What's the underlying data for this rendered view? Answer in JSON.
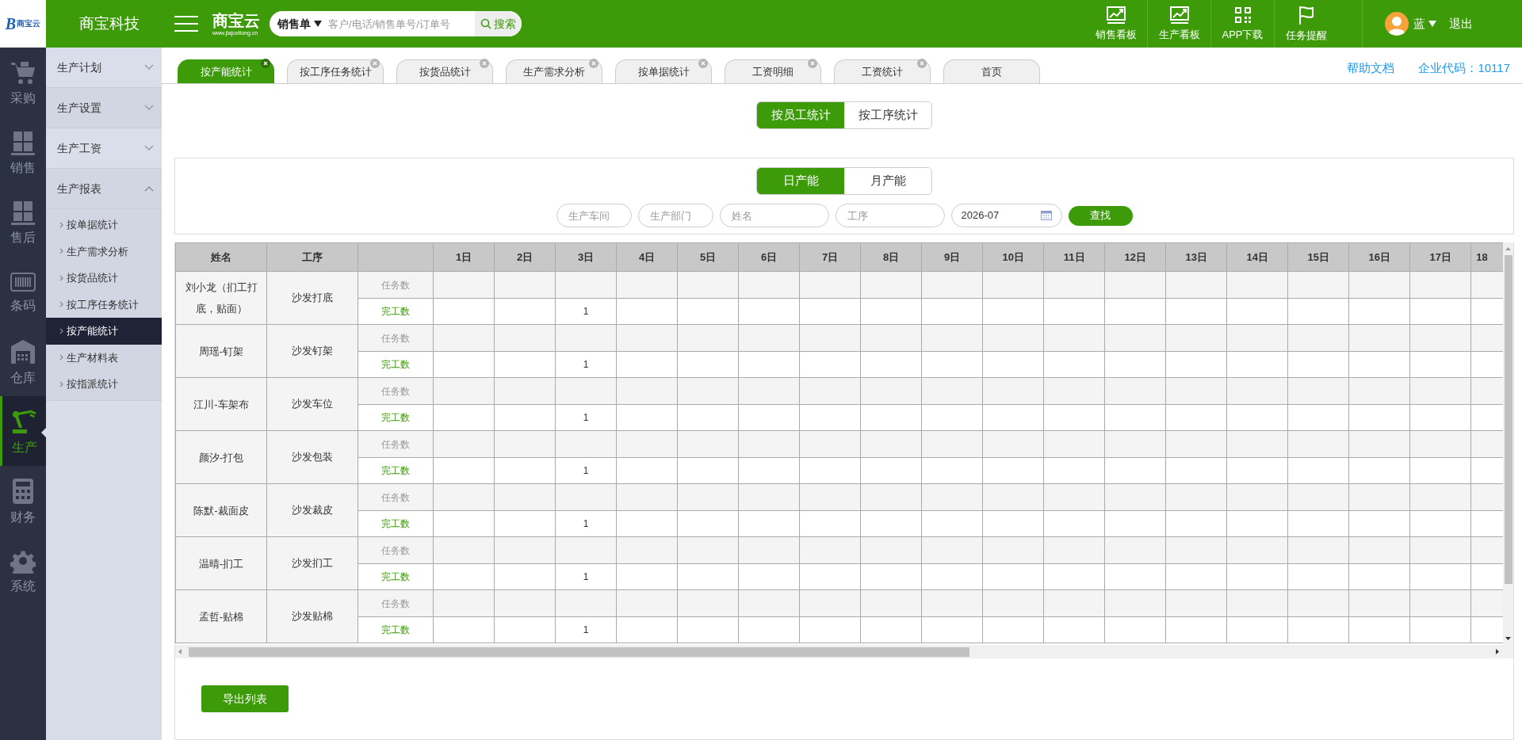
{
  "header": {
    "logo": {
      "letter": "B",
      "name": "商宝云"
    },
    "company": "商宝科技",
    "brand": {
      "name": "商宝云",
      "url": "www.jiajuxitong.cn"
    },
    "search": {
      "scope": "销售单",
      "placeholder": "客户/电话/销售单号/订单号",
      "button": "搜索"
    },
    "shortcuts": [
      {
        "label": "销售看板",
        "kind": "chart"
      },
      {
        "label": "生产看板",
        "kind": "chart"
      },
      {
        "label": "APP下载",
        "kind": "qr"
      },
      {
        "label": "任务提醒",
        "kind": "flag"
      }
    ],
    "user": {
      "name": "蓝"
    },
    "logout": "退出"
  },
  "rail": [
    {
      "label": "采购",
      "kind": "cart",
      "selected": false
    },
    {
      "label": "销售",
      "kind": "boxes",
      "selected": false
    },
    {
      "label": "售后",
      "kind": "boxes",
      "selected": false
    },
    {
      "label": "条码",
      "kind": "barcode",
      "selected": false
    },
    {
      "label": "仓库",
      "kind": "warehouse",
      "selected": false
    },
    {
      "label": "生产",
      "kind": "robot",
      "selected": true
    },
    {
      "label": "财务",
      "kind": "calculator",
      "selected": false
    },
    {
      "label": "系统",
      "kind": "gear",
      "selected": false
    }
  ],
  "menu": [
    {
      "label": "生产计划",
      "expanded": false
    },
    {
      "label": "生产设置",
      "expanded": false
    },
    {
      "label": "生产工资",
      "expanded": false
    },
    {
      "label": "生产报表",
      "expanded": true,
      "children": [
        {
          "label": "按单据统计",
          "selected": false
        },
        {
          "label": "生产需求分析",
          "selected": false
        },
        {
          "label": "按货品统计",
          "selected": false
        },
        {
          "label": "按工序任务统计",
          "selected": false
        },
        {
          "label": "按产能统计",
          "selected": true
        },
        {
          "label": "生产材料表",
          "selected": false
        },
        {
          "label": "按指派统计",
          "selected": false
        }
      ]
    }
  ],
  "tabs": [
    {
      "label": "按产能统计",
      "selected": true,
      "closable": true
    },
    {
      "label": "按工序任务统计",
      "selected": false,
      "closable": true
    },
    {
      "label": "按货品统计",
      "selected": false,
      "closable": true
    },
    {
      "label": "生产需求分析",
      "selected": false,
      "closable": true
    },
    {
      "label": "按单据统计",
      "selected": false,
      "closable": true
    },
    {
      "label": "工资明细",
      "selected": false,
      "closable": true
    },
    {
      "label": "工资统计",
      "selected": false,
      "closable": true
    },
    {
      "label": "首页",
      "selected": false,
      "closable": false
    }
  ],
  "help_link": "帮助文档",
  "company_code": "企业代码：10117",
  "view_toggle": [
    {
      "label": "按员工统计",
      "selected": true
    },
    {
      "label": "按工序统计",
      "selected": false
    }
  ],
  "period_toggle": [
    {
      "label": "日产能",
      "selected": true
    },
    {
      "label": "月产能",
      "selected": false
    }
  ],
  "filters": [
    {
      "kind": "text",
      "placeholder": "生产车间"
    },
    {
      "kind": "text",
      "placeholder": "生产部门"
    },
    {
      "kind": "text",
      "placeholder": "姓名"
    },
    {
      "kind": "text",
      "placeholder": "工序"
    },
    {
      "kind": "date",
      "value": "2026-07"
    }
  ],
  "find_button": "查找",
  "table": {
    "columns": [
      "姓名",
      "工序"
    ],
    "days": [
      "1日",
      "2日",
      "3日",
      "4日",
      "5日",
      "6日",
      "7日",
      "8日",
      "9日",
      "10日",
      "11日",
      "12日",
      "13日",
      "14日",
      "15日",
      "16日",
      "17日",
      "18"
    ],
    "rows": [
      {
        "name": "刘小龙（扪工打底，贴面）",
        "process": "沙发打底",
        "lines": [
          {
            "kind": "task",
            "label": "任务数"
          },
          {
            "kind": "done",
            "label": "完工数",
            "cells": [
              null,
              null,
              "1"
            ]
          }
        ]
      },
      {
        "name": "周瑶-钉架",
        "process": "沙发钉架",
        "lines": [
          {
            "kind": "task",
            "label": "任务数"
          },
          {
            "kind": "done",
            "label": "完工数",
            "cells": [
              null,
              null,
              "1"
            ]
          }
        ]
      },
      {
        "name": "江川-车架布",
        "process": "沙发车位",
        "lines": [
          {
            "kind": "task",
            "label": "任务数"
          },
          {
            "kind": "done",
            "label": "完工数",
            "cells": [
              null,
              null,
              "1"
            ]
          }
        ]
      },
      {
        "name": "颜汐-打包",
        "process": "沙发包装",
        "lines": [
          {
            "kind": "task",
            "label": "任务数"
          },
          {
            "kind": "done",
            "label": "完工数",
            "cells": [
              null,
              null,
              "1"
            ]
          }
        ]
      },
      {
        "name": "陈默-裁面皮",
        "process": "沙发裁皮",
        "lines": [
          {
            "kind": "task",
            "label": "任务数"
          },
          {
            "kind": "done",
            "label": "完工数",
            "cells": [
              null,
              null,
              "1"
            ]
          }
        ]
      },
      {
        "name": "温晴-扪工",
        "process": "沙发扪工",
        "lines": [
          {
            "kind": "task",
            "label": "任务数"
          },
          {
            "kind": "done",
            "label": "完工数",
            "cells": [
              null,
              null,
              "1"
            ]
          }
        ]
      },
      {
        "name": "孟哲-贴棉",
        "process": "沙发贴棉",
        "lines": [
          {
            "kind": "task",
            "label": "任务数"
          },
          {
            "kind": "done",
            "label": "完工数",
            "cells": [
              null,
              null,
              "1"
            ]
          }
        ]
      }
    ]
  },
  "export_button": "导出列表"
}
